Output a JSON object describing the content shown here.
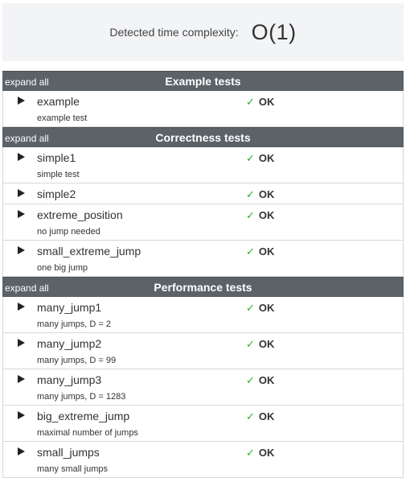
{
  "complexity": {
    "label": "Detected time complexity:",
    "value": "O(1)"
  },
  "colors": {
    "header_bg": "#5b6268",
    "ok_check": "#2bae2b",
    "panel_bg": "#f3f4f6"
  },
  "groups": [
    {
      "expand_label": "expand all",
      "title": "Example tests",
      "tests": [
        {
          "name": "example",
          "desc": "example test",
          "status": "OK"
        }
      ]
    },
    {
      "expand_label": "expand all",
      "title": "Correctness tests",
      "tests": [
        {
          "name": "simple1",
          "desc": "simple test",
          "status": "OK"
        },
        {
          "name": "simple2",
          "desc": "",
          "status": "OK"
        },
        {
          "name": "extreme_position",
          "desc": "no jump needed",
          "status": "OK"
        },
        {
          "name": "small_extreme_jump",
          "desc": "one big jump",
          "status": "OK"
        }
      ]
    },
    {
      "expand_label": "expand all",
      "title": "Performance tests",
      "tests": [
        {
          "name": "many_jump1",
          "desc": "many jumps, D = 2",
          "status": "OK"
        },
        {
          "name": "many_jump2",
          "desc": "many jumps, D = 99",
          "status": "OK"
        },
        {
          "name": "many_jump3",
          "desc": "many jumps, D = 1283",
          "status": "OK"
        },
        {
          "name": "big_extreme_jump",
          "desc": "maximal number of jumps",
          "status": "OK"
        },
        {
          "name": "small_jumps",
          "desc": "many small jumps",
          "status": "OK"
        }
      ]
    }
  ]
}
